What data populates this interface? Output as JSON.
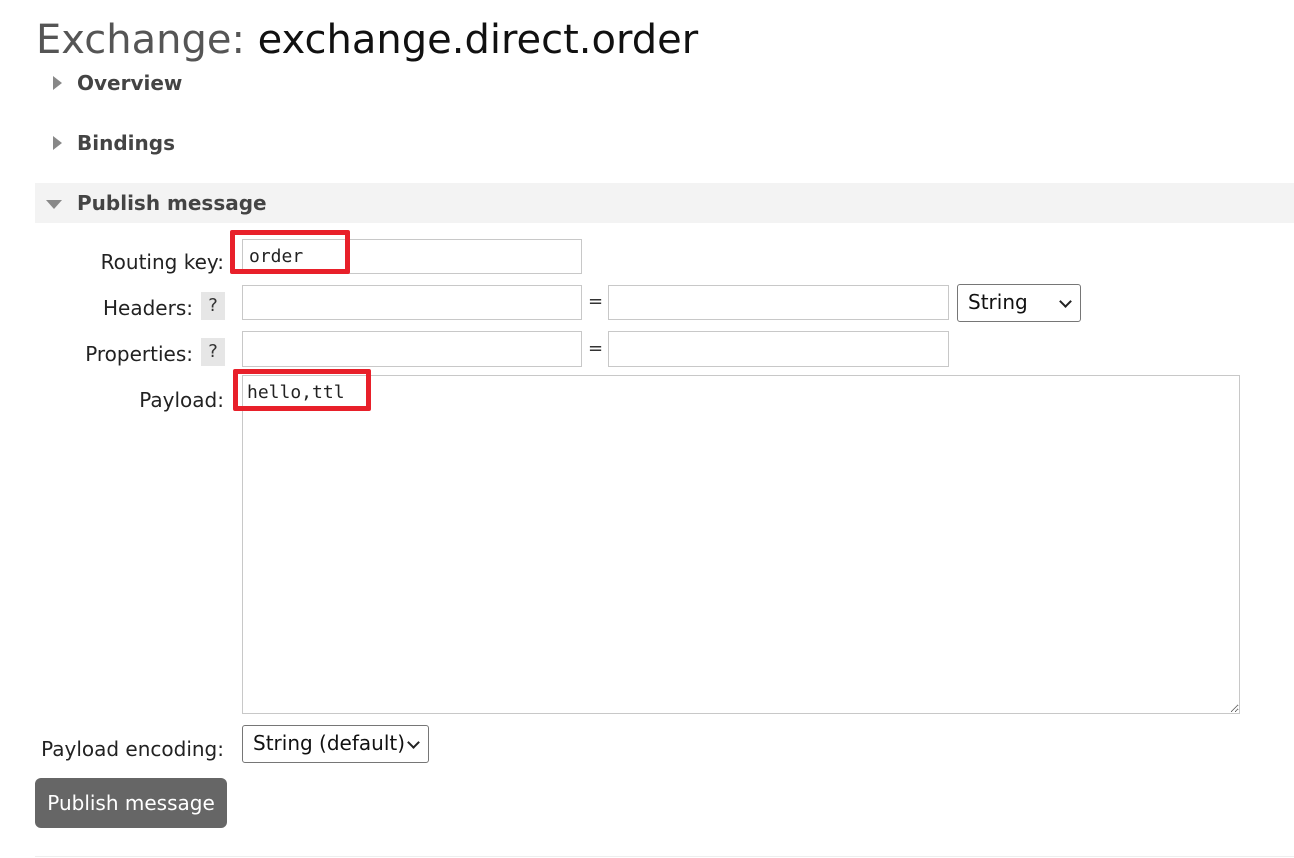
{
  "header": {
    "label": "Exchange:",
    "exchange_name": "exchange.direct.order"
  },
  "sections": {
    "overview": "Overview",
    "bindings": "Bindings",
    "publish": "Publish message"
  },
  "form": {
    "routing_key_label": "Routing key:",
    "routing_key_value": "order",
    "headers_label": "Headers:",
    "properties_label": "Properties:",
    "help_symbol": "?",
    "equals": "=",
    "header_type_selected": "String",
    "payload_label": "Payload:",
    "payload_value": "hello,ttl",
    "payload_encoding_label": "Payload encoding:",
    "payload_encoding_selected": "String (default)"
  },
  "actions": {
    "publish_button": "Publish message"
  },
  "colors": {
    "highlight": "#e8202a",
    "button_bg": "#666666"
  }
}
